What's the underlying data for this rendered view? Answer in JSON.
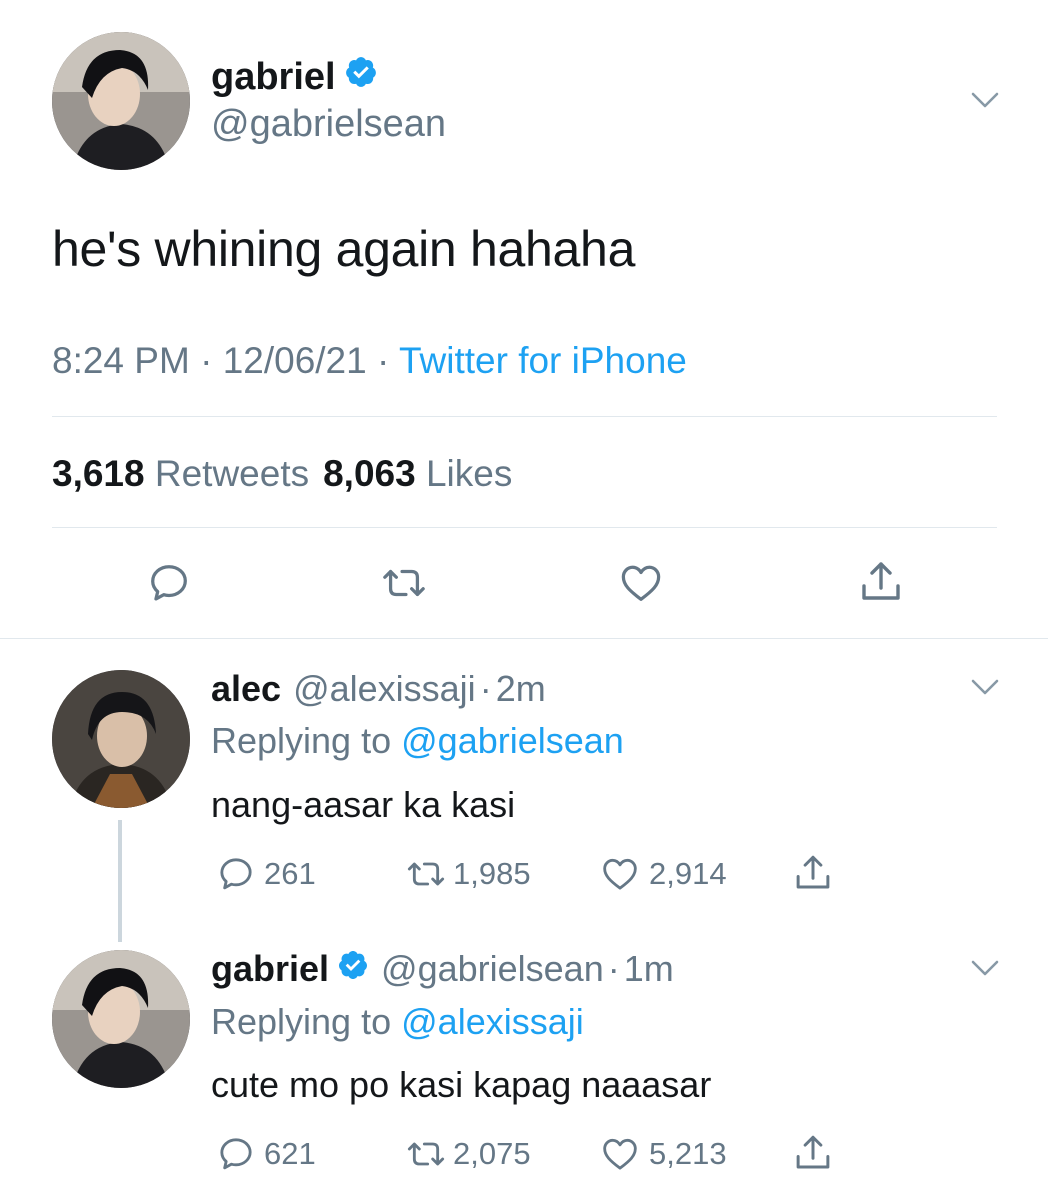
{
  "main_tweet": {
    "author": {
      "name": "gabriel",
      "handle": "@gabrielsean",
      "verified": true
    },
    "text": "he's whining again hahaha",
    "time": "8:24 PM",
    "date": "12/06/21",
    "source": "Twitter for iPhone",
    "separator": "·",
    "retweets_count": "3,618",
    "retweets_label": "Retweets",
    "likes_count": "8,063",
    "likes_label": "Likes"
  },
  "replies": [
    {
      "name": "alec",
      "handle": "@alexissaji",
      "separator": "·",
      "time": "2m",
      "verified": false,
      "replying_prefix": "Replying to",
      "replying_to": "@gabrielsean",
      "text": "nang-aasar ka kasi",
      "replies_count": "261",
      "retweets_count": "1,985",
      "likes_count": "2,914"
    },
    {
      "name": "gabriel",
      "handle": "@gabrielsean",
      "separator": "·",
      "time": "1m",
      "verified": true,
      "replying_prefix": "Replying to",
      "replying_to": "@alexissaji",
      "text": "cute mo po kasi kapag naaasar",
      "replies_count": "621",
      "retweets_count": "2,075",
      "likes_count": "5,213"
    }
  ],
  "colors": {
    "accent": "#1da1f2",
    "muted": "#657786",
    "text": "#14171a",
    "divider": "#e1e8ed"
  },
  "icons": [
    "verified-badge-icon",
    "chevron-down-icon",
    "reply-icon",
    "retweet-icon",
    "like-icon",
    "share-icon"
  ]
}
